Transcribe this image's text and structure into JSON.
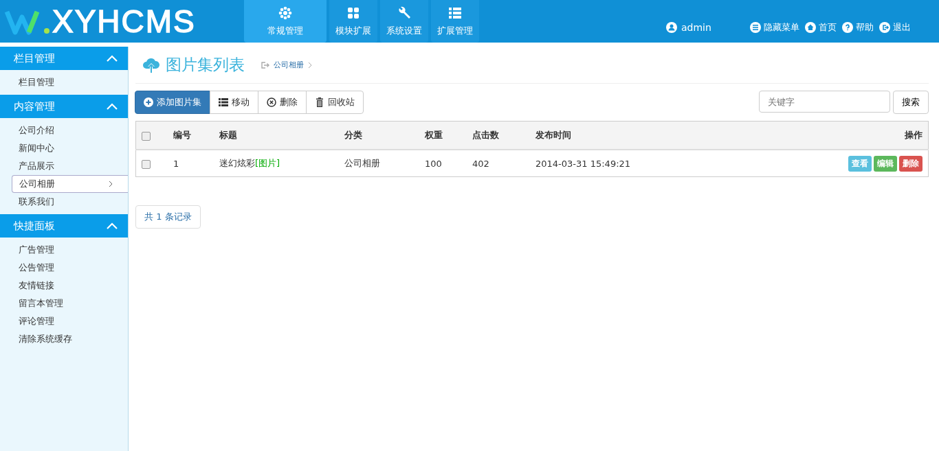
{
  "logo": {
    "text": "XYHCMS"
  },
  "nav": [
    {
      "label": "常规管理",
      "selected": true
    },
    {
      "label": "模块扩展",
      "selected": false
    },
    {
      "label": "系统设置",
      "selected": false
    },
    {
      "label": "扩展管理",
      "selected": false
    }
  ],
  "user": "admin",
  "top_links": [
    {
      "label": "隐藏菜单"
    },
    {
      "label": "首页"
    },
    {
      "label": "帮助"
    },
    {
      "label": "退出"
    }
  ],
  "sidebar": [
    {
      "title": "栏目管理",
      "expanded": true,
      "items": [
        {
          "label": "栏目管理",
          "selected": false
        }
      ]
    },
    {
      "title": "内容管理",
      "expanded": true,
      "items": [
        {
          "label": "公司介绍",
          "selected": false
        },
        {
          "label": "新闻中心",
          "selected": false
        },
        {
          "label": "产品展示",
          "selected": false
        },
        {
          "label": "公司相册",
          "selected": true
        },
        {
          "label": "联系我们",
          "selected": false
        }
      ]
    },
    {
      "title": "快捷面板",
      "expanded": true,
      "items": [
        {
          "label": "广告管理",
          "selected": false
        },
        {
          "label": "公告管理",
          "selected": false
        },
        {
          "label": "友情链接",
          "selected": false
        },
        {
          "label": "留言本管理",
          "selected": false
        },
        {
          "label": "评论管理",
          "selected": false
        },
        {
          "label": "清除系统缓存",
          "selected": false
        }
      ]
    }
  ],
  "page_title": "图片集列表",
  "breadcrumb": "公司相册",
  "toolbar": [
    {
      "label": "添加图片集",
      "primary": true
    },
    {
      "label": "移动",
      "primary": false
    },
    {
      "label": "删除",
      "primary": false
    },
    {
      "label": "回收站",
      "primary": false
    }
  ],
  "search": {
    "placeholder": "关键字",
    "button": "搜索"
  },
  "table": {
    "select_all_checked": false,
    "columns": [
      "编号",
      "标题",
      "分类",
      "权重",
      "点击数",
      "发布时间",
      "操作"
    ],
    "rows": [
      {
        "checked": false,
        "id": "1",
        "title": "迷幻炫彩",
        "tag": "[图片]",
        "category": "公司相册",
        "weight": "100",
        "clicks": "402",
        "time": "2014-03-31 15:49:21",
        "actions": [
          {
            "label": "查看",
            "kind": "view"
          },
          {
            "label": "编辑",
            "kind": "edit"
          },
          {
            "label": "删除",
            "kind": "delete"
          }
        ]
      }
    ]
  },
  "record_count": "共 1 条记录"
}
